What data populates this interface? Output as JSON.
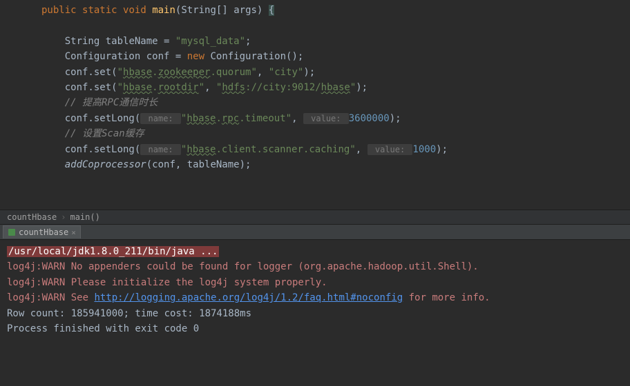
{
  "code": {
    "signature": {
      "kw1": "public",
      "kw2": "static",
      "kw3": "void",
      "method": "main",
      "params_prefix": "(",
      "params_type": "String[]",
      "params_name": " args) ",
      "brace": "{"
    },
    "l1": {
      "indent": "    ",
      "type": "String",
      "rest": " tableName = ",
      "str": "\"mysql_data\"",
      "end": ";"
    },
    "l2": {
      "indent": "    ",
      "type1": "Configuration",
      "mid": " conf = ",
      "kw": "new",
      "sp": " ",
      "type2": "Configuration",
      "end": "();"
    },
    "l3": {
      "indent": "    conf.set(",
      "s1a": "\"",
      "s1b": "hbase",
      "s1c": ".",
      "s1d": "zookeeper",
      "s1e": ".quorum\"",
      "comma": ", ",
      "s2": "\"city\"",
      "end": ");"
    },
    "l4": {
      "indent": "    conf.set(",
      "s1a": "\"",
      "s1b": "hbase",
      "s1c": ".",
      "s1d": "rootdir",
      "s1e": "\"",
      "comma": ", ",
      "s2a": "\"",
      "s2b": "hdfs",
      "s2c": "://city:9012/",
      "s2d": "hbase",
      "s2e": "\"",
      "end": ");"
    },
    "c1": "    // 提高RPC通信时长",
    "l5": {
      "indent": "    conf.setLong(",
      "hint1": " name: ",
      "s1a": "\"",
      "s1b": "hbase",
      "s1c": ".",
      "s1d": "rpc",
      "s1e": ".timeout\"",
      "comma": ", ",
      "hint2": " value: ",
      "num": "3600000",
      "end": ");"
    },
    "c2": "    // 设置Scan缓存",
    "l6": {
      "indent": "    conf.setLong(",
      "hint1": " name: ",
      "s1a": "\"",
      "s1b": "hbase",
      "s1c": ".client.scanner.caching\"",
      "comma": ", ",
      "hint2": " value: ",
      "num": "1000",
      "end": ");"
    },
    "l7": {
      "indent": "    ",
      "call": "addCoprocessor",
      "args": "(conf, tableName);"
    }
  },
  "breadcrumb": {
    "item1": "countHbase",
    "item2": "main()"
  },
  "console_tab": {
    "label": "countHbase",
    "close": "×"
  },
  "console": {
    "cmd": "/usr/local/jdk1.8.0_211/bin/java ...",
    "w1": "log4j:WARN No appenders could be found for logger (org.apache.hadoop.util.Shell).",
    "w2": "log4j:WARN Please initialize the log4j system properly.",
    "w3a": "log4j:WARN See ",
    "w3link": "http://logging.apache.org/log4j/1.2/faq.html#noconfig",
    "w3b": " for more info.",
    "out1": "Row count: 185941000; time cost: 1874188ms",
    "blank": "",
    "out2": "Process finished with exit code 0"
  }
}
